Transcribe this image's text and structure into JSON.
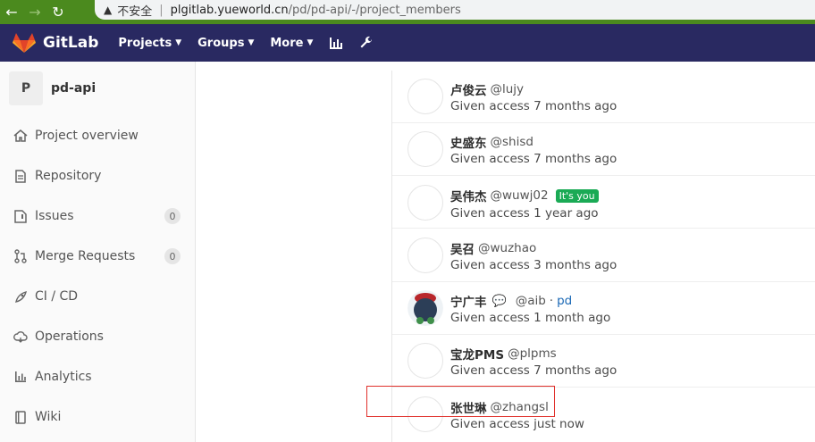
{
  "browser": {
    "insecure_label": "不安全",
    "url_host": "plgitlab.yueworld.cn",
    "url_path": "/pd/pd-api/-/project_members"
  },
  "header": {
    "brand": "GitLab",
    "nav": [
      "Projects",
      "Groups",
      "More"
    ],
    "icons": [
      "chart-icon",
      "wrench-icon"
    ]
  },
  "sidebar": {
    "project_initial": "P",
    "project_name": "pd-api",
    "items": [
      {
        "label": "Project overview",
        "icon": "home-icon"
      },
      {
        "label": "Repository",
        "icon": "file-icon"
      },
      {
        "label": "Issues",
        "icon": "issues-icon",
        "count": "0"
      },
      {
        "label": "Merge Requests",
        "icon": "merge-request-icon",
        "count": "0"
      },
      {
        "label": "CI / CD",
        "icon": "rocket-icon"
      },
      {
        "label": "Operations",
        "icon": "cloud-icon"
      },
      {
        "label": "Analytics",
        "icon": "chart-icon"
      },
      {
        "label": "Wiki",
        "icon": "book-icon"
      }
    ]
  },
  "members": [
    {
      "name": "卢俊云",
      "handle": "@lujy",
      "access": "Given access 7 months ago"
    },
    {
      "name": "史盛东",
      "handle": "@shisd",
      "access": "Given access 7 months ago"
    },
    {
      "name": "吴伟杰",
      "handle": "@wuwj02",
      "badge": "It's you",
      "access": "Given access 1 year ago"
    },
    {
      "name": "吴召",
      "handle": "@wuzhao",
      "access": "Given access 3 months ago"
    },
    {
      "name": "宁广丰",
      "emoji": "💬",
      "handle": "@aib",
      "sep": "·",
      "group": "pd",
      "access": "Given access 1 month ago"
    },
    {
      "name": "宝龙PMS",
      "handle": "@plpms",
      "access": "Given access 7 months ago"
    },
    {
      "name": "张世琳",
      "handle": "@zhangsl",
      "access": "Given access just now"
    }
  ],
  "colors": {
    "header_bg": "#292961",
    "browser_bg": "#4b8a1e",
    "badge_green": "#1aaa55",
    "highlight_red": "#e0312c",
    "link": "#1b69b6"
  }
}
